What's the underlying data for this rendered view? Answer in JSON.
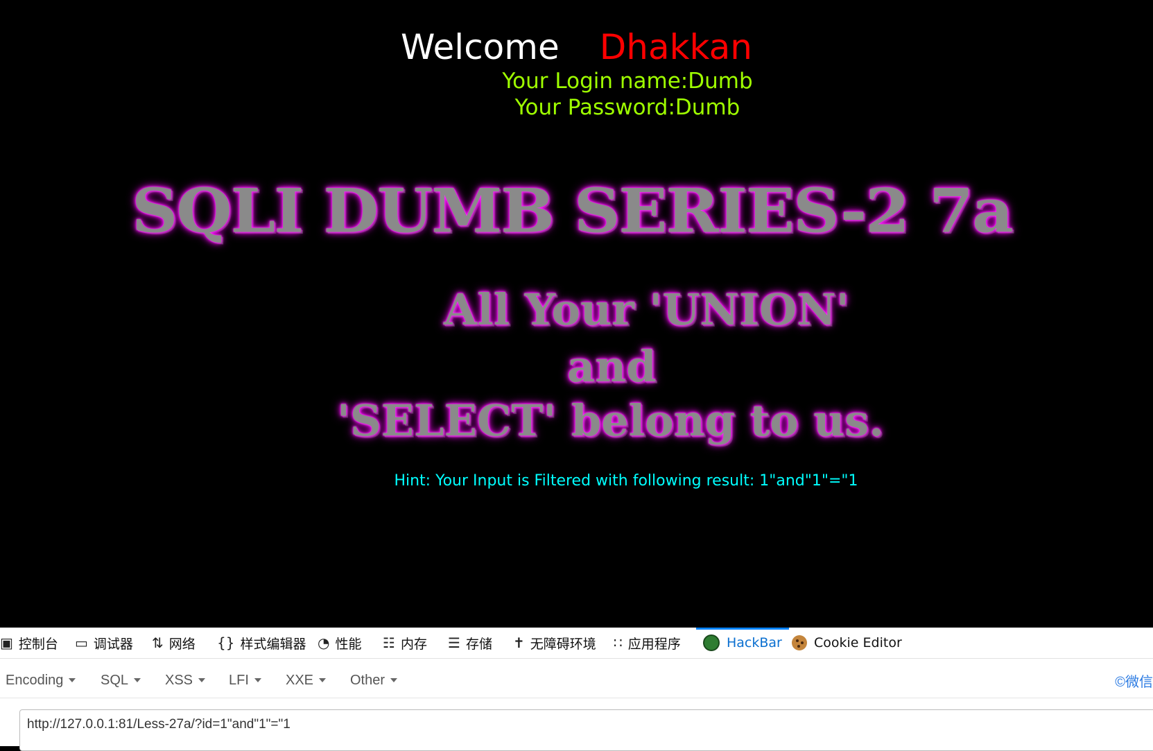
{
  "page": {
    "welcome": "Welcome",
    "user": "Dhakkan",
    "login_line": "Your Login name:Dumb",
    "password_line": "Your Password:Dumb",
    "banner_title": "SQLI DUMB SERIES-2 7a",
    "banner_line1": "All Your 'UNION'",
    "banner_line2": "and",
    "banner_line3": "'SELECT' belong to us.",
    "hint": "Hint: Your Input is Filtered with following result: 1\"and\"1\"=\"1"
  },
  "devtools": {
    "tabs": [
      {
        "label": "控制台",
        "icon": "console-icon"
      },
      {
        "label": "调试器",
        "icon": "debugger-icon"
      },
      {
        "label": "网络",
        "icon": "network-icon"
      },
      {
        "label": "样式编辑器",
        "icon": "style-editor-icon"
      },
      {
        "label": "性能",
        "icon": "performance-icon"
      },
      {
        "label": "内存",
        "icon": "memory-icon"
      },
      {
        "label": "存储",
        "icon": "storage-icon"
      },
      {
        "label": "无障碍环境",
        "icon": "accessibility-icon"
      },
      {
        "label": "应用程序",
        "icon": "application-icon"
      },
      {
        "label": "HackBar",
        "icon": "hackbar-icon"
      },
      {
        "label": "Cookie Editor",
        "icon": "cookie-icon"
      }
    ],
    "active_tab": "HackBar"
  },
  "hackbar": {
    "menus": [
      "Encoding",
      "SQL",
      "XSS",
      "LFI",
      "XXE",
      "Other"
    ],
    "right_text": "©微信",
    "url": "http://127.0.0.1:81/Less-27a/?id=1\"and\"1\"=\"1"
  },
  "colors": {
    "background": "#000000",
    "welcome": "#ffffff",
    "user": "#ff0000",
    "login_info": "#9fff00",
    "hint": "#00ffff",
    "banner_glow": "#ff22ff",
    "active_tab": "#0a6fd0"
  }
}
